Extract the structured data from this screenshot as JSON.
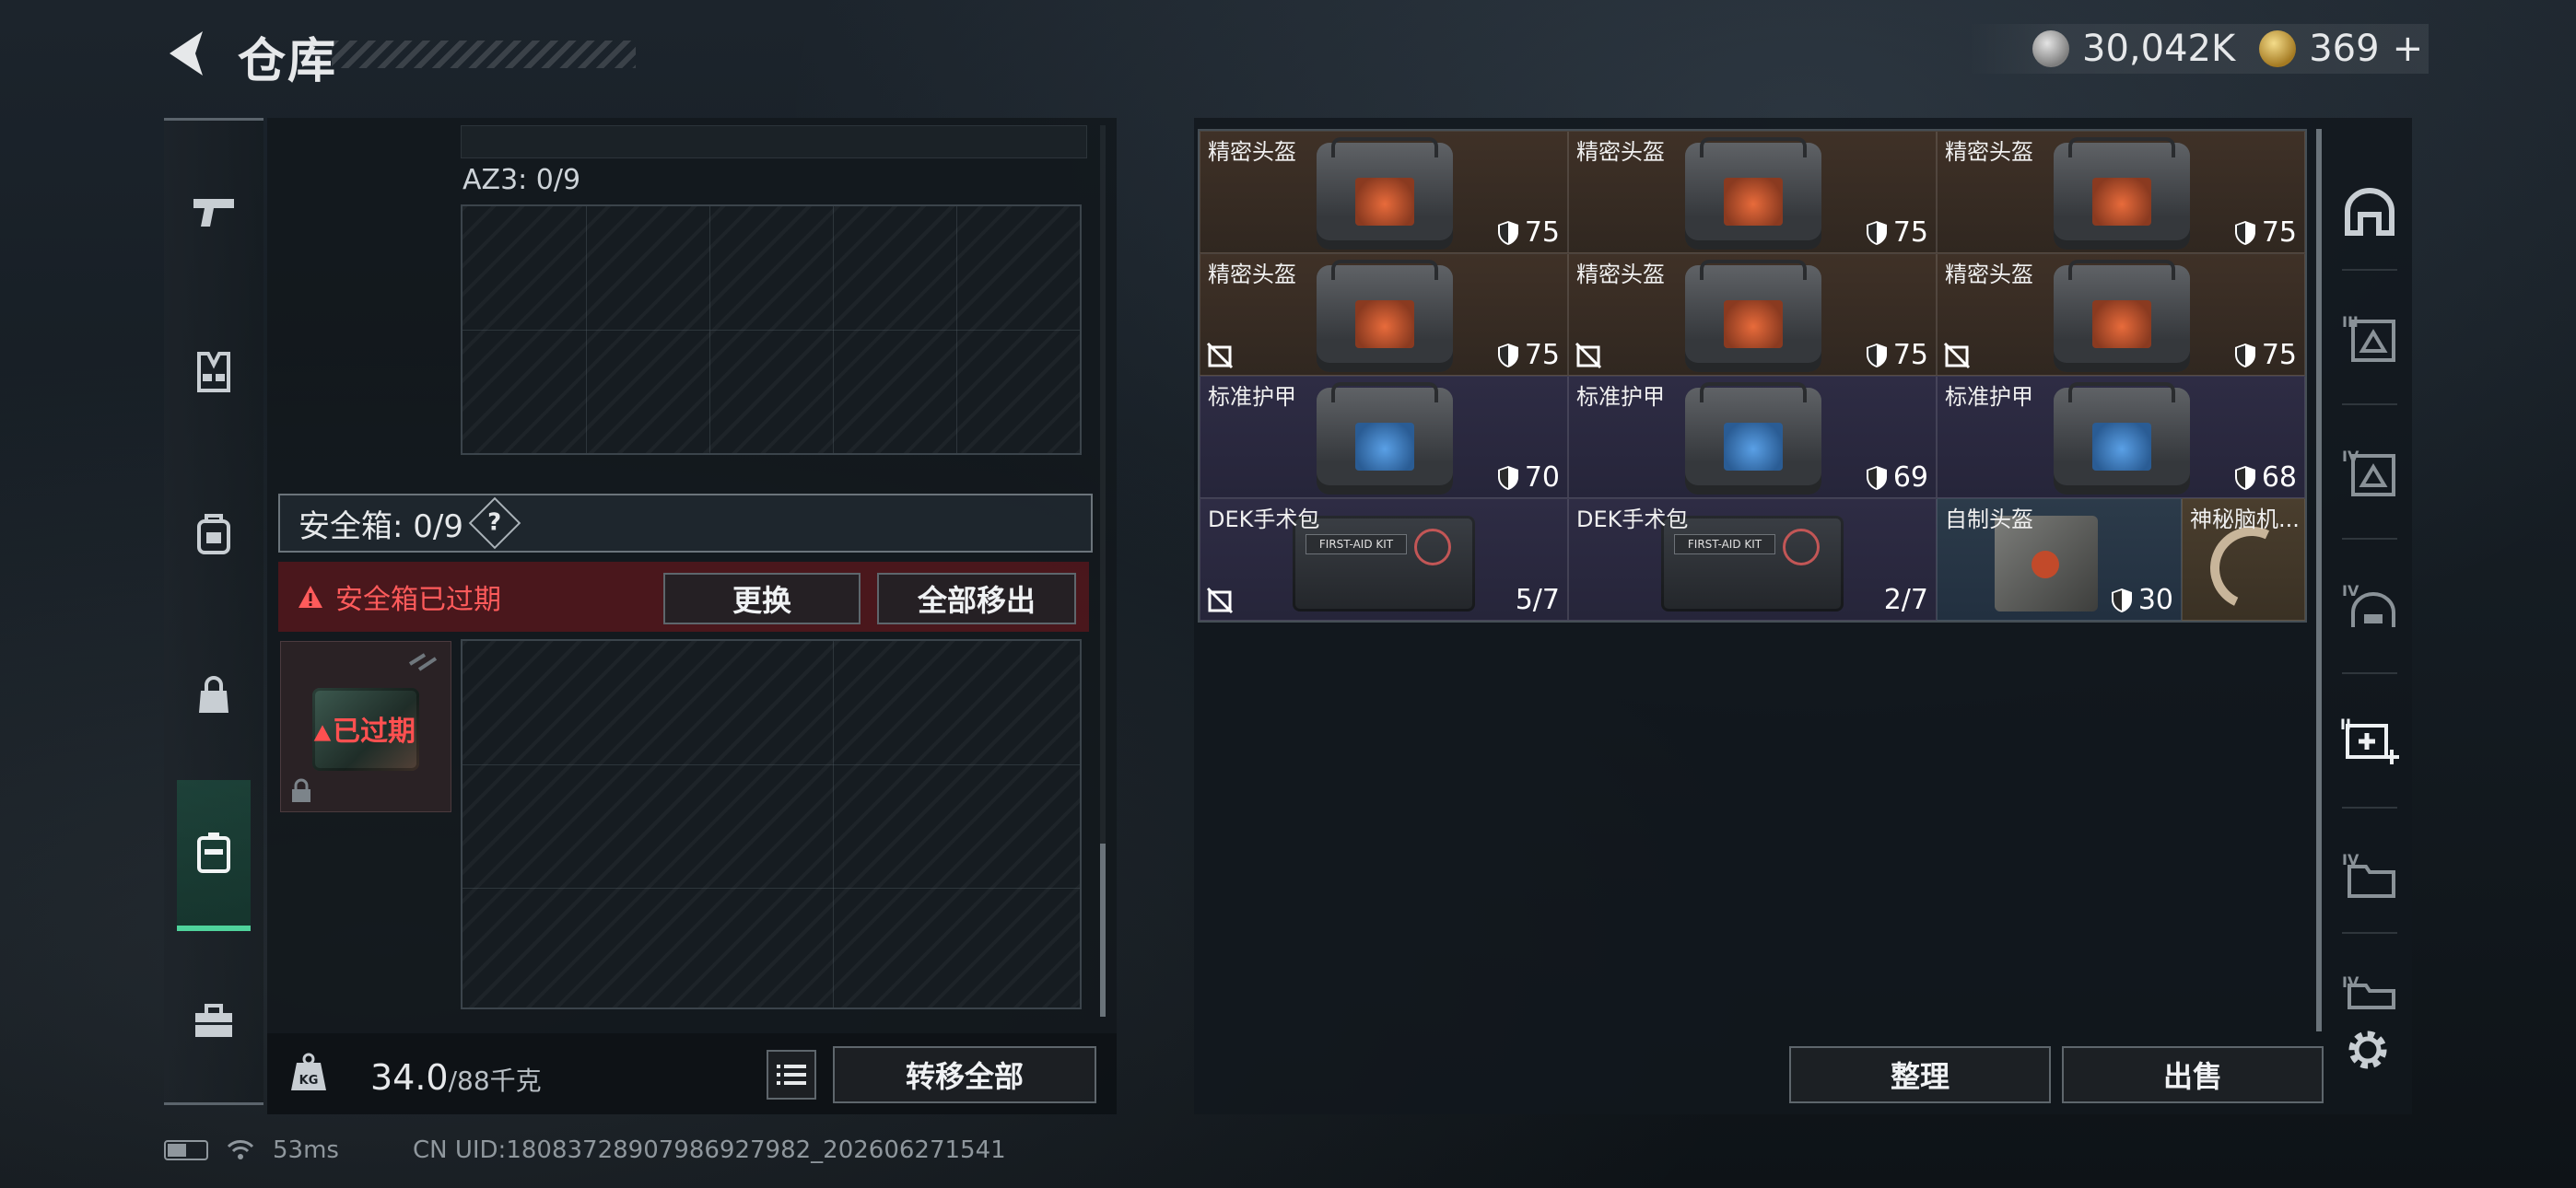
{
  "header": {
    "title": "仓库",
    "silver": "30,042K",
    "gold": "369",
    "gold_plus": "+"
  },
  "left": {
    "az3_label": "AZ3: 0/9",
    "safebox_label": "安全箱: 0/9",
    "help_mark": "?",
    "expired_msg": "安全箱已过期",
    "replace_btn": "更换",
    "move_all_btn": "全部移出",
    "safe_item_status": "已过期",
    "weight_value": "34.0",
    "weight_max": "/88千克",
    "transfer_all_btn": "转移全部"
  },
  "inventory": {
    "items": [
      {
        "name": "精密头盔",
        "value": "75",
        "tone": "brown",
        "kind": "bag",
        "patch": "orange",
        "nodash": false
      },
      {
        "name": "精密头盔",
        "value": "75",
        "tone": "brown",
        "kind": "bag",
        "patch": "orange",
        "nodash": false
      },
      {
        "name": "精密头盔",
        "value": "75",
        "tone": "brown",
        "kind": "bag",
        "patch": "orange",
        "nodash": false
      },
      {
        "name": "精密头盔",
        "value": "75",
        "tone": "brown",
        "kind": "bag",
        "patch": "orange",
        "nodash": true
      },
      {
        "name": "精密头盔",
        "value": "75",
        "tone": "brown",
        "kind": "bag",
        "patch": "orange",
        "nodash": true
      },
      {
        "name": "精密头盔",
        "value": "75",
        "tone": "brown",
        "kind": "bag",
        "patch": "orange",
        "nodash": true
      },
      {
        "name": "标准护甲",
        "value": "70",
        "tone": "purple",
        "kind": "bag",
        "patch": "blue",
        "nodash": false
      },
      {
        "name": "标准护甲",
        "value": "69",
        "tone": "purple",
        "kind": "bag",
        "patch": "blue",
        "nodash": false
      },
      {
        "name": "标准护甲",
        "value": "68",
        "tone": "purple",
        "kind": "bag",
        "patch": "blue",
        "nodash": false
      },
      {
        "name": "DEK手术包",
        "value": "5/7",
        "tone": "purple",
        "kind": "kit",
        "nodash": true,
        "kit_label": "FIRST-AID KIT"
      },
      {
        "name": "DEK手术包",
        "value": "2/7",
        "tone": "purple",
        "kind": "kit",
        "nodash": false,
        "kit_label": "FIRST-AID KIT"
      },
      {
        "name": "自制头盔",
        "value": "30",
        "tone": "blue",
        "kind": "case",
        "nodash": false
      },
      {
        "name": "神秘脑机...",
        "value": "",
        "tone": "tan",
        "kind": "cable",
        "nodash": false
      }
    ]
  },
  "right": {
    "sort_btn": "整理",
    "sell_btn": "出售"
  },
  "footer": {
    "ping": "53ms",
    "uid": "CN UID:18083728907986927982_202606271541"
  },
  "icons": {
    "left_nav": [
      "pistol-icon",
      "vest-icon",
      "backpack-icon",
      "bag-icon",
      "safebox-icon",
      "toolbox-icon"
    ],
    "right_nav": [
      "helmet-icon",
      "armor-tier3-icon",
      "armor-tier4-icon",
      "helmet-tier4-icon",
      "medkit-icon",
      "folder-tier4-icon",
      "folder-tier4b-icon"
    ]
  },
  "colors": {
    "accent_green": "#4fd39c",
    "expired_red": "#ff5b5b"
  }
}
